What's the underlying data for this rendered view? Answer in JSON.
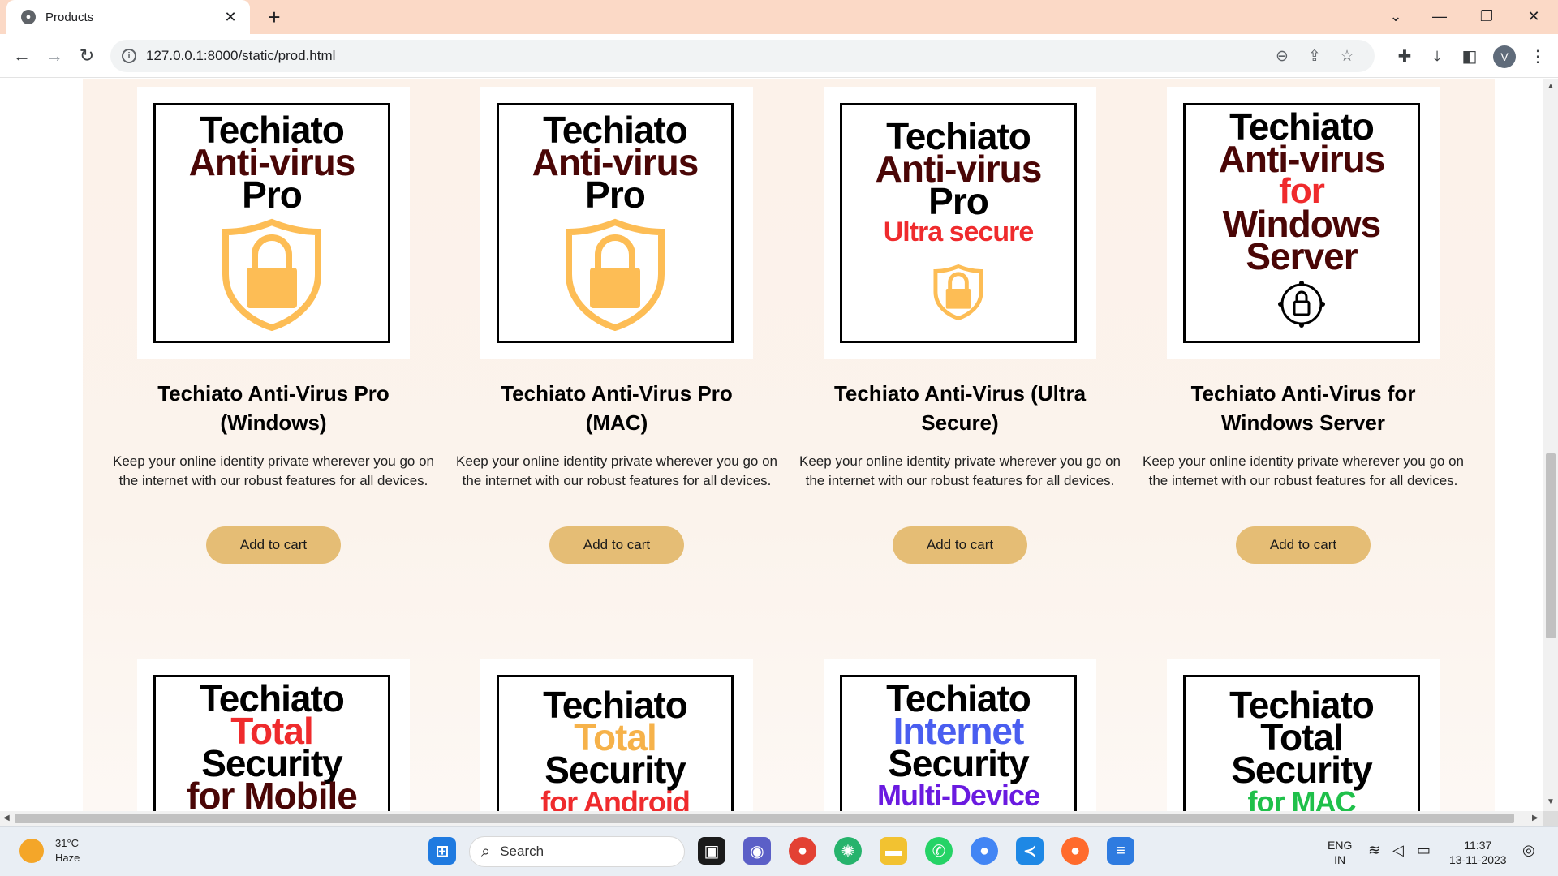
{
  "browser": {
    "tab_title": "Products",
    "tab_close": "✕",
    "new_tab": "+",
    "url": "127.0.0.1:8000/static/prod.html",
    "avatar_letter": "V"
  },
  "products_row1": [
    {
      "img_lines": [
        "Techiato",
        "Anti-virus",
        "Pro"
      ],
      "img_extra": "",
      "name": "Techiato Anti-Virus Pro (Windows)",
      "desc": "Keep your online identity private wherever you go on the internet with our robust features for all devices.",
      "button": "Add to cart",
      "icon": "shield-lock-icon"
    },
    {
      "img_lines": [
        "Techiato",
        "Anti-virus",
        "Pro"
      ],
      "img_extra": "",
      "name": "Techiato Anti-Virus Pro (MAC)",
      "desc": "Keep your online identity private wherever you go on the internet with our robust features for all devices.",
      "button": "Add to cart",
      "icon": "shield-lock-icon"
    },
    {
      "img_lines": [
        "Techiato",
        "Anti-virus",
        "Pro"
      ],
      "img_extra": "Ultra secure",
      "name": "Techiato Anti-Virus (Ultra Secure)",
      "desc": "Keep your online identity private wherever you go on the internet with our robust features for all devices.",
      "button": "Add to cart",
      "icon": "shield-lock-icon"
    },
    {
      "img_lines": [
        "Techiato",
        "Anti-virus",
        "for",
        "Windows",
        "Server"
      ],
      "img_extra": "",
      "name": "Techiato Anti-Virus for Windows Server",
      "desc": "Keep your online identity private wherever you go on the internet with our robust features for all devices.",
      "button": "Add to cart",
      "icon": "network-lock-icon"
    }
  ],
  "products_row2": [
    {
      "lines": [
        "Techiato",
        "Total",
        "Security",
        "for Mobile"
      ],
      "accent": "#ef2b2d"
    },
    {
      "lines": [
        "Techiato",
        "Total",
        "Security",
        "for Android"
      ],
      "accent": "#f6b24a"
    },
    {
      "lines": [
        "Techiato",
        "Internet",
        "Security",
        "Multi-Device"
      ],
      "accent": "#4a5ef0"
    },
    {
      "lines": [
        "Techiato",
        "Total",
        "Security",
        "for MAC"
      ],
      "accent": "#1fc04a"
    }
  ],
  "taskbar": {
    "temp": "31°C",
    "weather": "Haze",
    "search_placeholder": "Search",
    "lang1": "ENG",
    "lang2": "IN",
    "time": "11:37",
    "date": "13-11-2023"
  },
  "colors": {
    "button": "#e5bd75",
    "titlebar": "#fbd9c6",
    "dark_red": "#4a0606"
  }
}
